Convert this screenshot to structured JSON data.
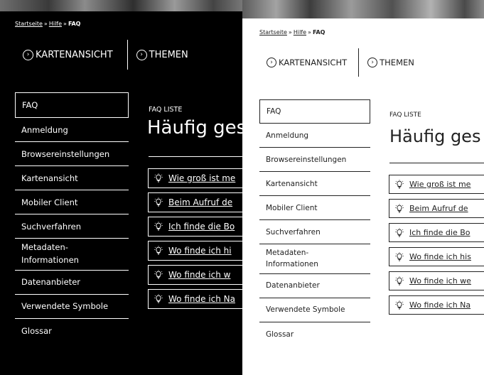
{
  "breadcrumb": {
    "home": "Startseite",
    "sep": "»",
    "help": "Hilfe",
    "current": "FAQ"
  },
  "tabs": [
    {
      "label": "KARTENANSICHT",
      "icon": "chevron-right-icon"
    },
    {
      "label": "THEMEN",
      "icon": "chevron-right-icon"
    }
  ],
  "sidebar": {
    "items": [
      {
        "label": "FAQ"
      },
      {
        "label": "Anmeldung"
      },
      {
        "label": "Browsereinstellungen"
      },
      {
        "label": "Kartenansicht"
      },
      {
        "label": "Mobiler Client"
      },
      {
        "label": "Suchverfahren"
      },
      {
        "label": "Metadaten-\nInformationen"
      },
      {
        "label": "Datenanbieter"
      },
      {
        "label": "Verwendete Symbole"
      },
      {
        "label": "Glossar"
      }
    ]
  },
  "main": {
    "list_label": "FAQ LISTE",
    "heading": "Häufig ges",
    "questions": [
      "Wie groß ist me",
      "Beim Aufruf de",
      "Ich finde die Bo",
      "Wo finde ich hi",
      "Wo finde ich w",
      "Wo finde ich Na"
    ],
    "questions_light": [
      "Wie groß ist me",
      "Beim Aufruf de",
      "Ich finde die Bo",
      "Wo finde ich his",
      "Wo finde ich we",
      "Wo finde ich Na"
    ]
  },
  "colors": {
    "dark_bg": "#000000",
    "dark_fg": "#ffffff",
    "light_bg": "#ffffff",
    "light_fg": "#222222"
  }
}
